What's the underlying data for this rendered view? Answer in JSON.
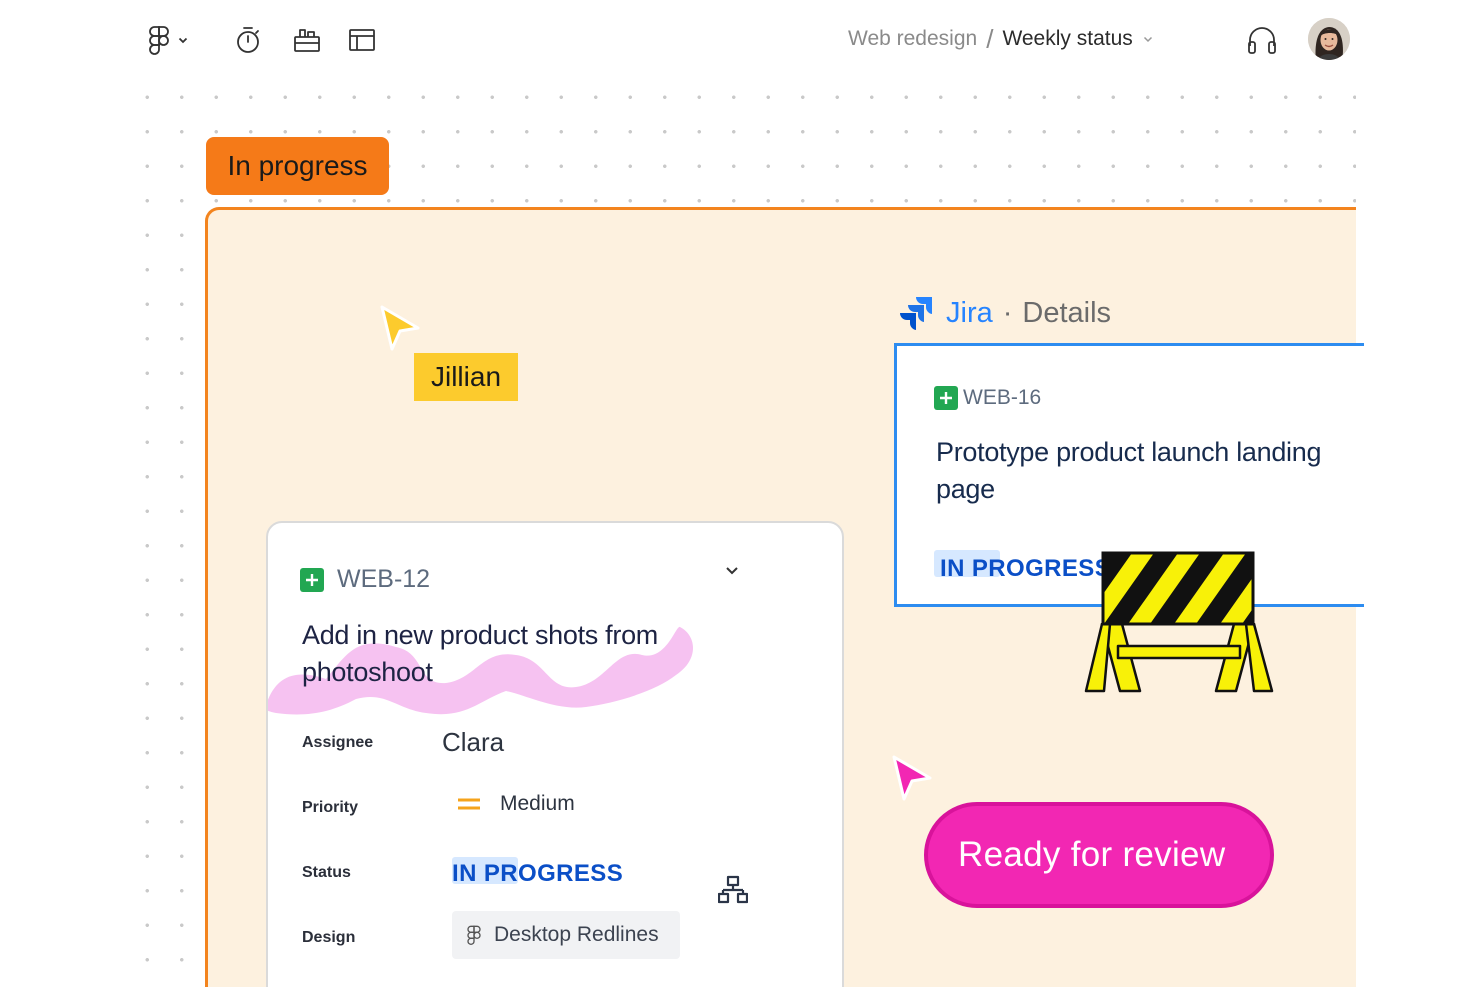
{
  "toolbar": {
    "menu_icon": "figma-logo-icon",
    "icons": [
      "timer-icon",
      "toolbox-icon",
      "layout-icon"
    ],
    "breadcrumb": {
      "project": "Web redesign",
      "separator": "/",
      "page": "Weekly status"
    },
    "right_icons": [
      "headphones-icon",
      "avatar"
    ]
  },
  "canvas": {
    "section_label": "In progress",
    "collaborators": [
      {
        "name": "Jillian",
        "cursor_color": "#fccb2d"
      },
      {
        "name": "",
        "cursor_color": "#f227b3"
      }
    ],
    "jira_panel": {
      "app_name": "Jira",
      "separator": "·",
      "panel_title": "Details",
      "issue_key": "WEB-16",
      "issue_title": "Prototype product launch landing page",
      "status": "IN PROGRESS"
    },
    "issue_card": {
      "issue_key": "WEB-12",
      "issue_title": "Add in new product shots from photoshoot",
      "fields": {
        "assignee_label": "Assignee",
        "assignee_value": "Clara",
        "priority_label": "Priority",
        "priority_value": "Medium",
        "status_label": "Status",
        "status_value": "IN PROGRESS",
        "design_label": "Design",
        "design_value": "Desktop Redlines"
      }
    },
    "sticker": "Ready for review"
  },
  "colors": {
    "section_orange": "#f57a18",
    "section_fill": "#fdf1df",
    "jira_blue": "#2684ff",
    "status_blue": "#0b4fc7",
    "review_pink": "#f227b3",
    "name_tag_yellow": "#fccb2d",
    "scribble_pink": "#f6c2f1"
  }
}
